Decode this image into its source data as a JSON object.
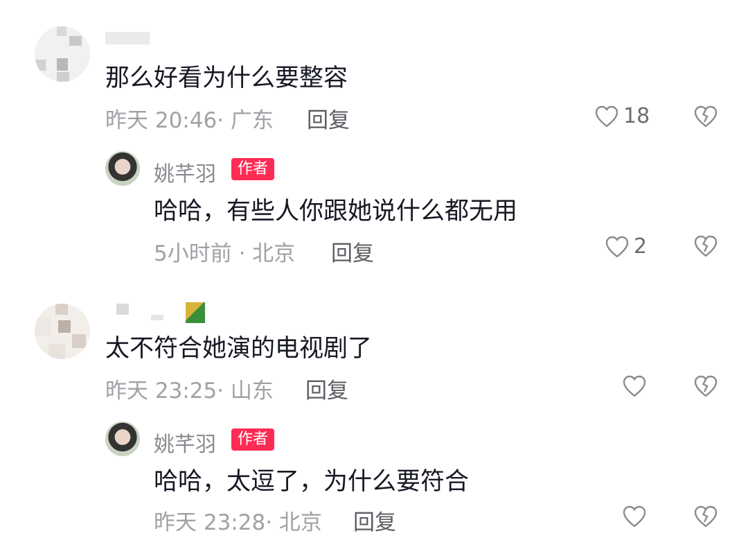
{
  "comments": [
    {
      "username": "",
      "text": "那么好看为什么要整容",
      "meta": "昨天 20:46· 广东",
      "reply_label": "回复",
      "likes": "18",
      "reply": {
        "username": "姚芊羽",
        "badge": "作者",
        "text": "哈哈，有些人你跟她说什么都无用",
        "meta": "5小时前 · 北京",
        "reply_label": "回复",
        "likes": "2"
      }
    },
    {
      "username": "",
      "text": "太不符合她演的电视剧了",
      "meta": "昨天 23:25· 山东",
      "reply_label": "回复",
      "likes": "",
      "reply": {
        "username": "姚芊羽",
        "badge": "作者",
        "text": "哈哈，太逗了，为什么要符合",
        "meta": "昨天 23:28· 北京",
        "reply_label": "回复",
        "likes": ""
      }
    }
  ],
  "icons": {
    "like": "heart-outline-icon",
    "dislike": "broken-heart-icon"
  },
  "colors": {
    "author_badge": "#fe2c55",
    "meta_text": "#a0a1a6",
    "username": "#8a8b91"
  }
}
